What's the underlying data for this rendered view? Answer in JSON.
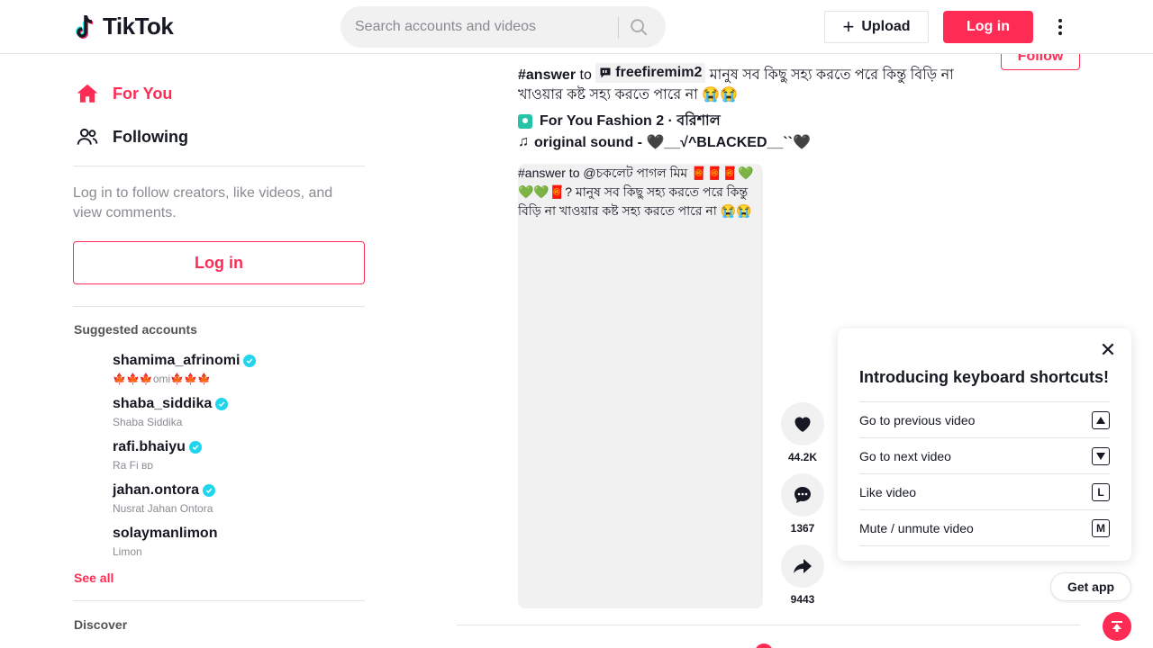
{
  "header": {
    "logo_text": "TikTok",
    "search_placeholder": "Search accounts and videos",
    "upload_label": "Upload",
    "login_label": "Log in"
  },
  "sidebar": {
    "nav": [
      {
        "label": "For You",
        "icon": "home-icon"
      },
      {
        "label": "Following",
        "icon": "people-icon"
      }
    ],
    "login_prompt": "Log in to follow creators, like videos, and view comments.",
    "login_label": "Log in",
    "suggested_title": "Suggested accounts",
    "accounts": [
      {
        "username": "shamima_afrinomi",
        "display": "🍁🍁🍁omi🍁🍁🍁",
        "verified": true
      },
      {
        "username": "shaba_siddika",
        "display": "Shaba Siddika",
        "verified": true
      },
      {
        "username": "rafi.bhaiyu",
        "display": "Ra Fi ʙᴅ",
        "verified": true
      },
      {
        "username": "jahan.ontora",
        "display": "Nusrat Jahan Ontora",
        "verified": true
      },
      {
        "username": "solaymanlimon",
        "display": "Limon",
        "verified": false
      }
    ],
    "see_all": "See all",
    "discover_title": "Discover"
  },
  "post": {
    "hashtag": "#answer",
    "to_word": "to",
    "mention": "freefiremim2",
    "caption_text": "মানুষ সব কিছু সহ্য করতে পরে কিন্তু বিড়ি না খাওয়ার কষ্ট সহ্য করতে পারে না 😭😭",
    "location": "For You Fashion 2 · বরিশাল",
    "music": "original sound - 🖤__√^BLACKED__``🖤",
    "follow_label": "Follow",
    "video_alt": "#answer to @চকলেট পাগল মিম 🧧🧧🧧💚💚💚🧧? মানুষ সব কিছু সহ্য করতে পরে কিন্তু বিড়ি না খাওয়ার কষ্ট সহ্য করতে পারে না 😭😭",
    "likes": "44.2K",
    "comments": "1367",
    "shares": "9443"
  },
  "shortcuts": {
    "title": "Introducing keyboard shortcuts!",
    "items": [
      {
        "label": "Go to previous video",
        "key": "▲"
      },
      {
        "label": "Go to next video",
        "key": "▼"
      },
      {
        "label": "Like video",
        "key": "L"
      },
      {
        "label": "Mute / unmute video",
        "key": "M"
      }
    ]
  },
  "get_app_label": "Get app",
  "colors": {
    "brand": "#fe2c55",
    "verified": "#20d5ec",
    "text": "#161823",
    "muted": "#8a8b91"
  }
}
